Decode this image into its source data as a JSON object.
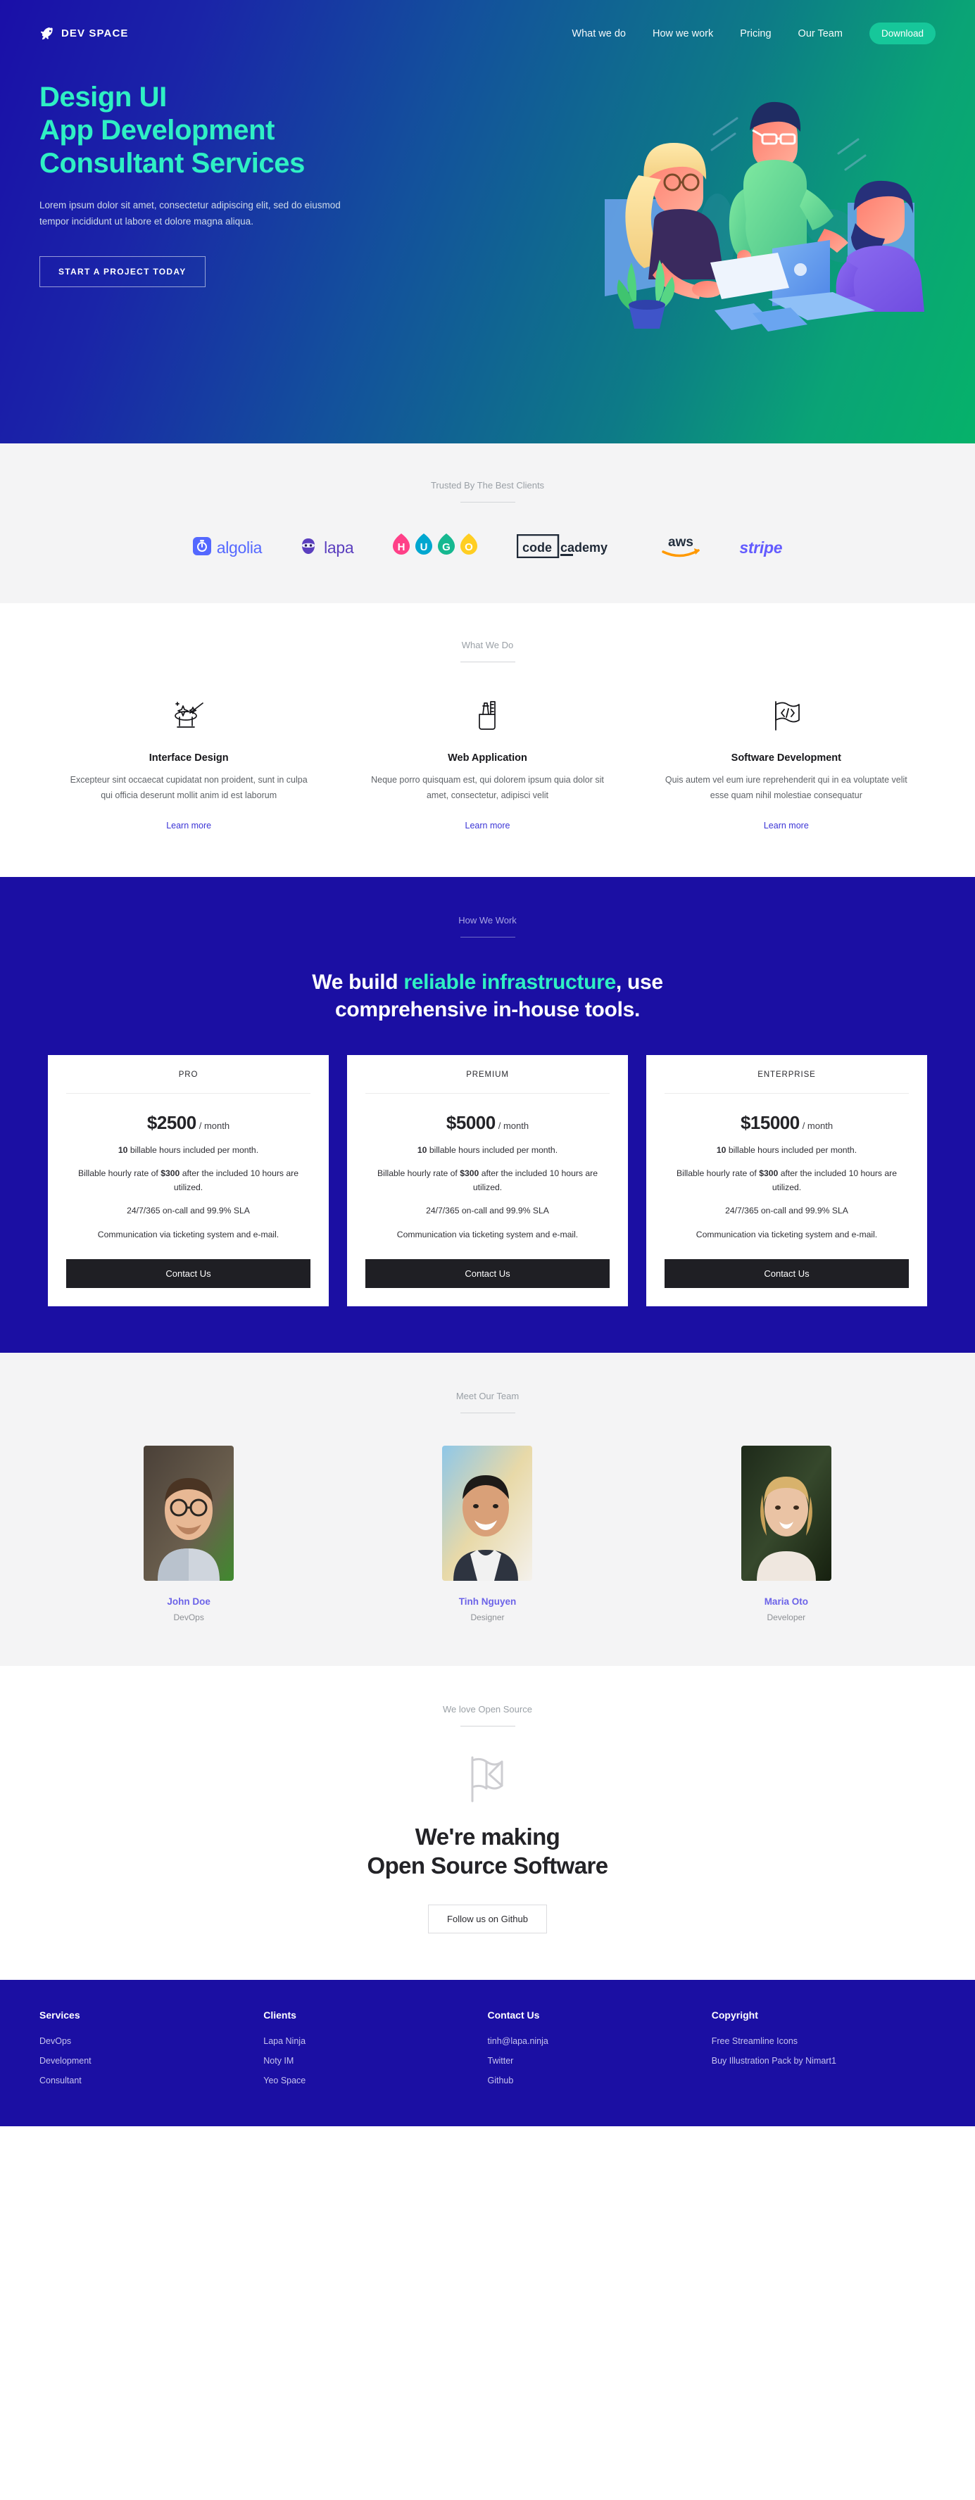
{
  "nav": {
    "brand": "DEV SPACE",
    "brand_icon": "rocket-icon",
    "links": [
      {
        "label": "What we do"
      },
      {
        "label": "How we work"
      },
      {
        "label": "Pricing"
      },
      {
        "label": "Our Team"
      }
    ],
    "cta": "Download",
    "cta_color": "#16c79a"
  },
  "hero": {
    "title_line1": "Design UI",
    "title_line2": "App Development",
    "title_line3": "Consultant Services",
    "title_color": "#2ff0c4",
    "paragraph": "Lorem ipsum dolor sit amet, consectetur adipiscing elit, sed do eiusmod tempor incididunt ut labore et dolore magna aliqua.",
    "button": "START A PROJECT TODAY",
    "illustration": "team-meeting-illustration"
  },
  "clients": {
    "eyebrow": "Trusted By The Best Clients",
    "logos": [
      {
        "name": "algolia",
        "icon": "algolia-logo",
        "color": "#5468ff"
      },
      {
        "name": "lapa",
        "icon": "lapa-ninja-logo",
        "color": "#5b3fbf"
      },
      {
        "name": "HUGO",
        "icon": "hugo-logo",
        "color": "#ff4088"
      },
      {
        "name": "codecademy",
        "icon": "codecademy-logo",
        "color": "#1f2937"
      },
      {
        "name": "aws",
        "icon": "aws-logo",
        "color": "#ff9900"
      },
      {
        "name": "stripe",
        "icon": "stripe-logo",
        "color": "#635bff"
      }
    ]
  },
  "services": {
    "eyebrow": "What We Do",
    "items": [
      {
        "icon": "magic-hat-icon",
        "title": "Interface Design",
        "desc": "Excepteur sint occaecat cupidatat non proident, sunt in culpa qui officia deserunt mollit anim id est laborum",
        "link": "Learn more"
      },
      {
        "icon": "pen-ruler-cup-icon",
        "title": "Web Application",
        "desc": "Neque porro quisquam est, qui dolorem ipsum quia dolor sit amet, consectetur, adipisci velit",
        "link": "Learn more"
      },
      {
        "icon": "code-flag-icon",
        "title": "Software Development",
        "desc": "Quis autem vel eum iure reprehenderit qui in ea voluptate velit esse quam nihil molestiae consequatur",
        "link": "Learn more"
      }
    ]
  },
  "work": {
    "eyebrow": "How We Work",
    "heading_a": "We build ",
    "heading_highlight": "reliable infrastructure",
    "heading_b": ", use",
    "heading_line2": "comprehensive in-house tools.",
    "highlight_color": "#2ff0c4",
    "plans": [
      {
        "name": "PRO",
        "amount": "$2500",
        "period": "/ month",
        "feature1_bold": "10",
        "feature1_rest": " billable hours included per month.",
        "feature2_a": "Billable hourly rate of ",
        "feature2_bold": "$300",
        "feature2_b": " after the included 10 hours are utilized.",
        "feature3": "24/7/365 on-call and 99.9% SLA",
        "feature4": "Communication via ticketing system and e-mail.",
        "button": "Contact Us"
      },
      {
        "name": "PREMIUM",
        "amount": "$5000",
        "period": "/ month",
        "feature1_bold": "10",
        "feature1_rest": " billable hours included per month.",
        "feature2_a": "Billable hourly rate of ",
        "feature2_bold": "$300",
        "feature2_b": " after the included 10 hours are utilized.",
        "feature3": "24/7/365 on-call and 99.9% SLA",
        "feature4": "Communication via ticketing system and e-mail.",
        "button": "Contact Us"
      },
      {
        "name": "ENTERPRISE",
        "amount": "$15000",
        "period": "/ month",
        "feature1_bold": "10",
        "feature1_rest": " billable hours included per month.",
        "feature2_a": "Billable hourly rate of ",
        "feature2_bold": "$300",
        "feature2_b": " after the included 10 hours are utilized.",
        "feature3": "24/7/365 on-call and 99.9% SLA",
        "feature4": "Communication via ticketing system and e-mail.",
        "button": "Contact Us"
      }
    ]
  },
  "team": {
    "eyebrow": "Meet Our Team",
    "members": [
      {
        "name": "John Doe",
        "role": "DevOps",
        "photo": "portrait-man-glasses"
      },
      {
        "name": "Tinh Nguyen",
        "role": "Designer",
        "photo": "portrait-man-smiling"
      },
      {
        "name": "Maria Oto",
        "role": "Developer",
        "photo": "portrait-woman-blonde"
      }
    ],
    "name_color": "#6c63e8"
  },
  "oss": {
    "eyebrow": "We love Open Source",
    "icon": "flag-icon",
    "heading_line1": "We're making",
    "heading_line2": "Open Source Software",
    "button": "Follow us on Github"
  },
  "footer": {
    "columns": [
      {
        "title": "Services",
        "links": [
          "DevOps",
          "Development",
          "Consultant"
        ]
      },
      {
        "title": "Clients",
        "links": [
          "Lapa Ninja",
          "Noty IM",
          "Yeo Space"
        ]
      },
      {
        "title": "Contact Us",
        "links": [
          "tinh@lapa.ninja",
          "Twitter",
          "Github"
        ]
      },
      {
        "title": "Copyright",
        "links": [
          "Free Streamline Icons",
          "Buy Illustration Pack by Nimart1"
        ]
      }
    ]
  }
}
